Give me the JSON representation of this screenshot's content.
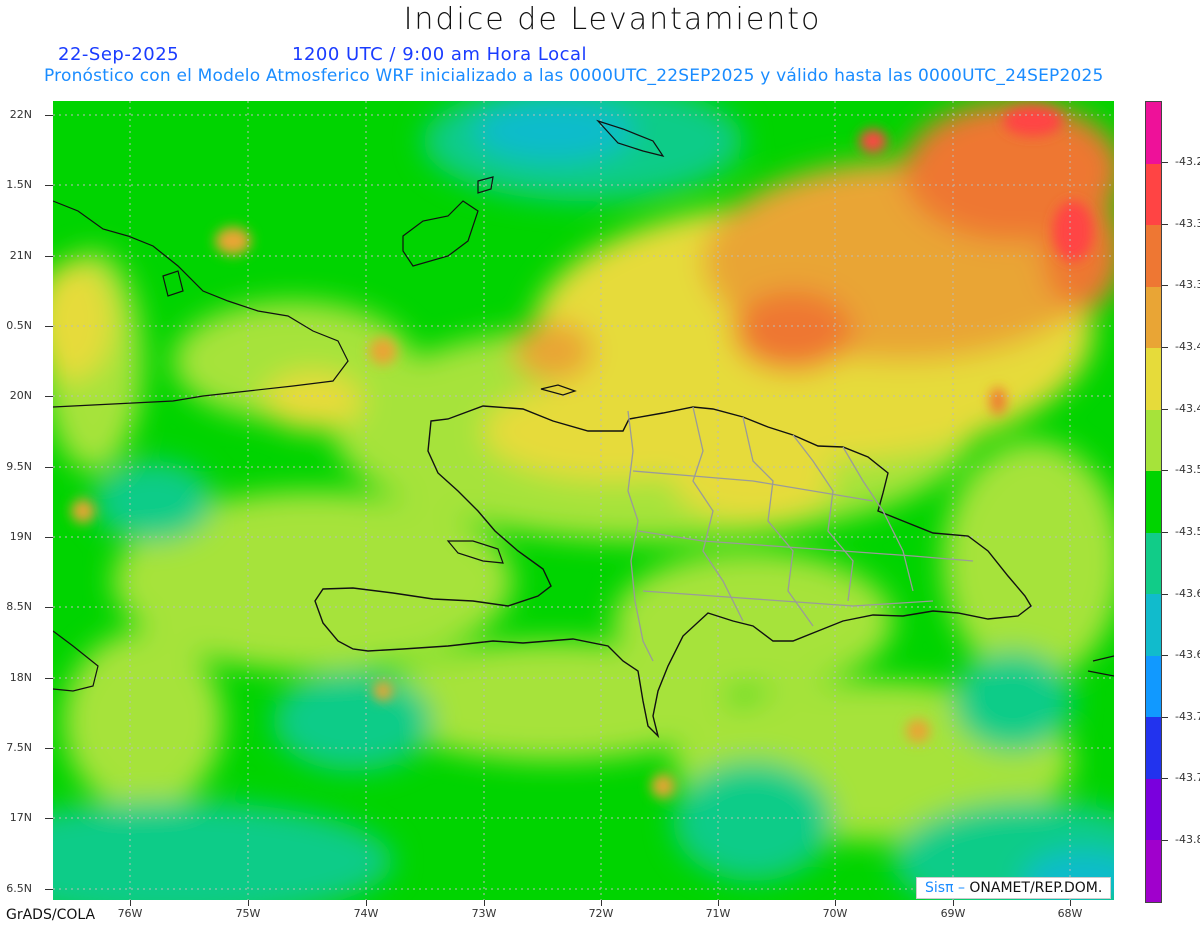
{
  "header": {
    "title": "Indice de Levantamiento",
    "date": "22-Sep-2025",
    "utc_line": "1200 UTC / 9:00 am Hora Local",
    "forecast_line": "Pronóstico con el Modelo Atmosferico WRF inicializado a las 0000UTC_22SEP2025 y válido hasta las  0000UTC_24SEP2025"
  },
  "map": {
    "lat_labels": [
      "22N",
      "1.5N",
      "21N",
      "0.5N",
      "20N",
      "9.5N",
      "19N",
      "8.5N",
      "18N",
      "7.5N",
      "17N",
      "6.5N"
    ],
    "lon_labels": [
      "76W",
      "75W",
      "74W",
      "73W",
      "72W",
      "71W",
      "70W",
      "69W",
      "68W"
    ],
    "lat_range": [
      16.5,
      22.2
    ],
    "lon_range": [
      -76.4,
      -67.4
    ],
    "region": "Hispaniola and surrounding Caribbean"
  },
  "colorbar": {
    "labels": [
      "-43.2",
      "-43.3",
      "-43.3",
      "-43.4",
      "-43.4",
      "-43.5",
      "-43.5",
      "-43.6",
      "-43.6",
      "-43.7",
      "-43.7",
      "-43.8"
    ],
    "colors": [
      "#ee1199",
      "#ff4444",
      "#ee7733",
      "#e9a535",
      "#e6db3a",
      "#a6e33a",
      "#00d400",
      "#11cc88",
      "#11bbcc",
      "#1199ff",
      "#2233ee",
      "#7a00dd",
      "#a000cc"
    ]
  },
  "credit": {
    "sis": "Sisπ –",
    "org": "ONAMET/REP.DOM."
  },
  "footer": {
    "text": "GrADS/COLA"
  }
}
